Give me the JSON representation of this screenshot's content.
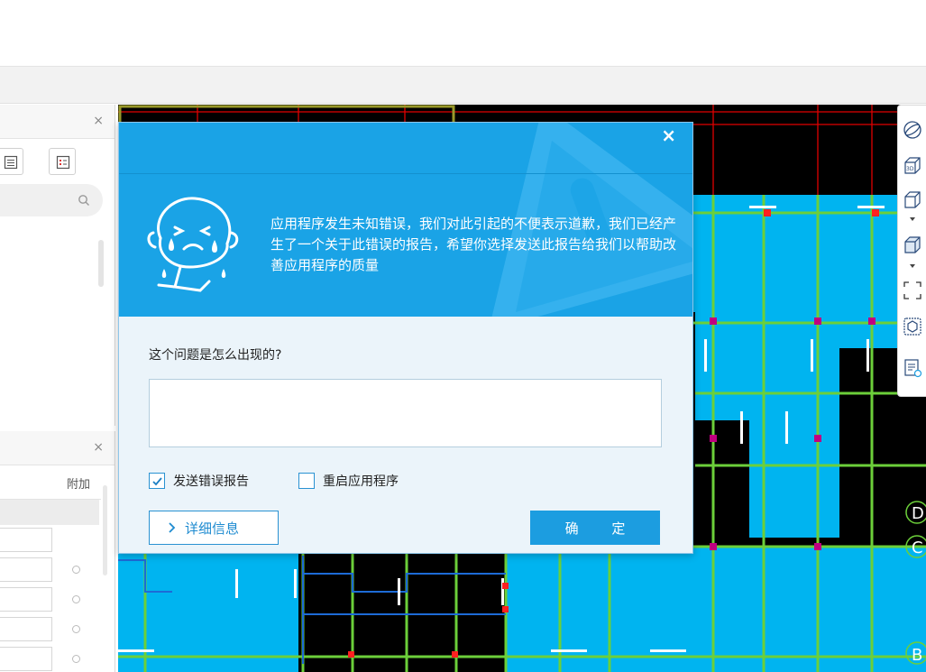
{
  "dialog": {
    "close_glyph": "×",
    "message": "应用程序发生未知错误，我们对此引起的不便表示道歉，我们已经产生了一个关于此错误的报告，希望你选择发送此报告给我们以帮助改善应用程序的质量",
    "question": "这个问题是怎么出现的?",
    "textarea_value": "",
    "send_report": {
      "label": "发送错误报告",
      "checked": true
    },
    "restart_app": {
      "label": "重启应用程序",
      "checked": false
    },
    "details_button": "详细信息",
    "ok_button": "确 定",
    "header_color": "#1aa3e6",
    "accent_color": "#2a92d2"
  },
  "left_panel_top": {
    "close_glyph": "×",
    "icons": [
      "list-view-icon",
      "detail-view-icon"
    ],
    "search_icon": "search-icon"
  },
  "left_panel_bottom": {
    "close_glyph": "×",
    "column_header": "附加"
  },
  "right_toolbar": {
    "icons": [
      "orbit-icon",
      "3d-view-icon",
      "cube-view-icon",
      "dropdown-arrow-icon",
      "cube-solid-icon",
      "dropdown-arrow-icon",
      "selection-frame-icon",
      "box-icon",
      "layer-settings-icon"
    ]
  },
  "cad_axis_labels": [
    "D",
    "C",
    "B"
  ]
}
